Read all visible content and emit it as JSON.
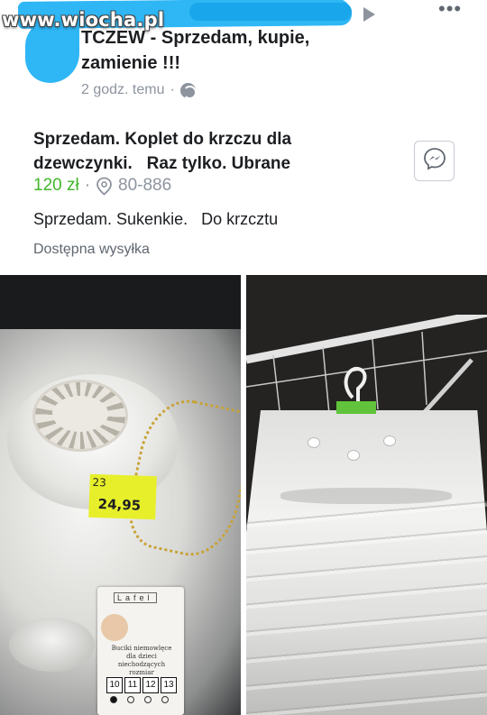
{
  "watermark": "www.wiocha.pl",
  "group": {
    "title": "TCZEW - Sprzedam, kupie, zamienie !!!",
    "time": "2 godz. temu",
    "separator": "·"
  },
  "listing": {
    "title": "Sprzedam. Koplet do krzczu dla dzewczynki.   Raz tylko. Ubrane",
    "price": "120 zł",
    "separator": "·",
    "location": "80-886",
    "description": "Sprzedam. Sukenkie.   Do krzcztu",
    "shipping": "Dostępna wysyłka"
  },
  "photo_left": {
    "tag_small": "23",
    "tag_price": "24,95",
    "card_brand": "Lafel",
    "card_text": "Buciki niemowlęce dla dzieci niechodzących rozmiar",
    "sizes": [
      "10",
      "11",
      "12",
      "13"
    ]
  },
  "icons": {
    "more": "more-options-icon",
    "globe": "globe-icon",
    "pin": "location-pin-icon",
    "messenger": "messenger-icon",
    "arrow": "play-arrow-icon"
  },
  "colors": {
    "price": "#42b72a",
    "scribble": "#2fb7f5",
    "meta": "#8d949e",
    "tag": "#e7ef2a"
  }
}
